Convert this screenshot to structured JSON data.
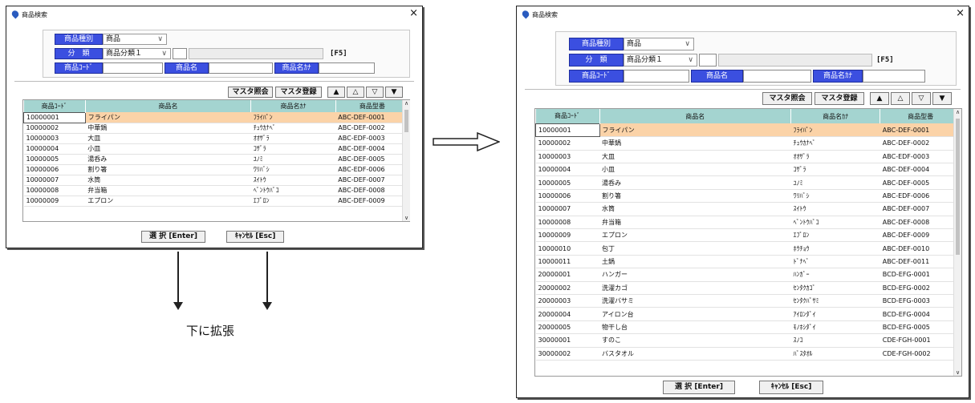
{
  "window_title": "商品検索",
  "close_glyph": "×",
  "labels": {
    "category": "商品種別",
    "class": "分　類",
    "code": "商品ｺｰﾄﾞ",
    "name": "商品名",
    "kana": "商品名ｶﾅ"
  },
  "fields": {
    "category_value": "商品",
    "class_value": "商品分類１",
    "class_code": "",
    "class_name": "",
    "code": "",
    "name": "",
    "kana": ""
  },
  "f5_hint": "[F5]",
  "buttons": {
    "master_ref": "マスタ照会",
    "master_reg": "マスタ登録",
    "first": "▲",
    "prev": "△",
    "next": "▽",
    "last": "▼",
    "select": "選 択 [Enter]",
    "cancel": "ｷｬﾝｾﾙ [Esc]"
  },
  "columns": [
    "商品ｺｰﾄﾞ",
    "商品名",
    "商品名ｶﾅ",
    "商品型番"
  ],
  "rows": [
    [
      "10000001",
      "フライパン",
      "ﾌﾗｲﾊﾟﾝ",
      "ABC-DEF-0001"
    ],
    [
      "10000002",
      "中華鍋",
      "ﾁｭｳｶﾅﾍﾞ",
      "ABC-DEF-0002"
    ],
    [
      "10000003",
      "大皿",
      "ｵｵｻﾞﾗ",
      "ABC-EDF-0003"
    ],
    [
      "10000004",
      "小皿",
      "ｺｻﾞﾗ",
      "ABC-DEF-0004"
    ],
    [
      "10000005",
      "湯呑み",
      "ﾕﾉﾐ",
      "ABC-DEF-0005"
    ],
    [
      "10000006",
      "割り箸",
      "ﾜﾘﾊﾞｼ",
      "ABC-EDF-0006"
    ],
    [
      "10000007",
      "水筒",
      "ｽｲﾄｳ",
      "ABC-DEF-0007"
    ],
    [
      "10000008",
      "弁当箱",
      "ﾍﾞﾝﾄｳﾊﾞｺ",
      "ABC-DEF-0008"
    ],
    [
      "10000009",
      "エプロン",
      "ｴﾌﾟﾛﾝ",
      "ABC-DEF-0009"
    ],
    [
      "10000010",
      "包丁",
      "ﾎｳﾁｮｳ",
      "ABC-DEF-0010"
    ],
    [
      "10000011",
      "土鍋",
      "ﾄﾞﾅﾍﾞ",
      "ABC-DEF-0011"
    ],
    [
      "20000001",
      "ハンガー",
      "ﾊﾝｶﾞｰ",
      "BCD-EFG-0001"
    ],
    [
      "20000002",
      "洗濯カゴ",
      "ｾﾝﾀｸｶｺﾞ",
      "BCD-EFG-0002"
    ],
    [
      "20000003",
      "洗濯バサミ",
      "ｾﾝﾀｸﾊﾞｻﾐ",
      "BCD-EFG-0003"
    ],
    [
      "20000004",
      "アイロン台",
      "ｱｲﾛﾝﾀﾞｲ",
      "BCD-EFG-0004"
    ],
    [
      "20000005",
      "物干し台",
      "ﾓﾉﾎｼﾀﾞｲ",
      "BCD-EFG-0005"
    ],
    [
      "30000001",
      "すのこ",
      "ｽﾉｺ",
      "CDE-FGH-0001"
    ],
    [
      "30000002",
      "バスタオル",
      "ﾊﾞｽﾀｵﾙ",
      "CDE-FGH-0002"
    ]
  ],
  "annotation": "下に拡張"
}
